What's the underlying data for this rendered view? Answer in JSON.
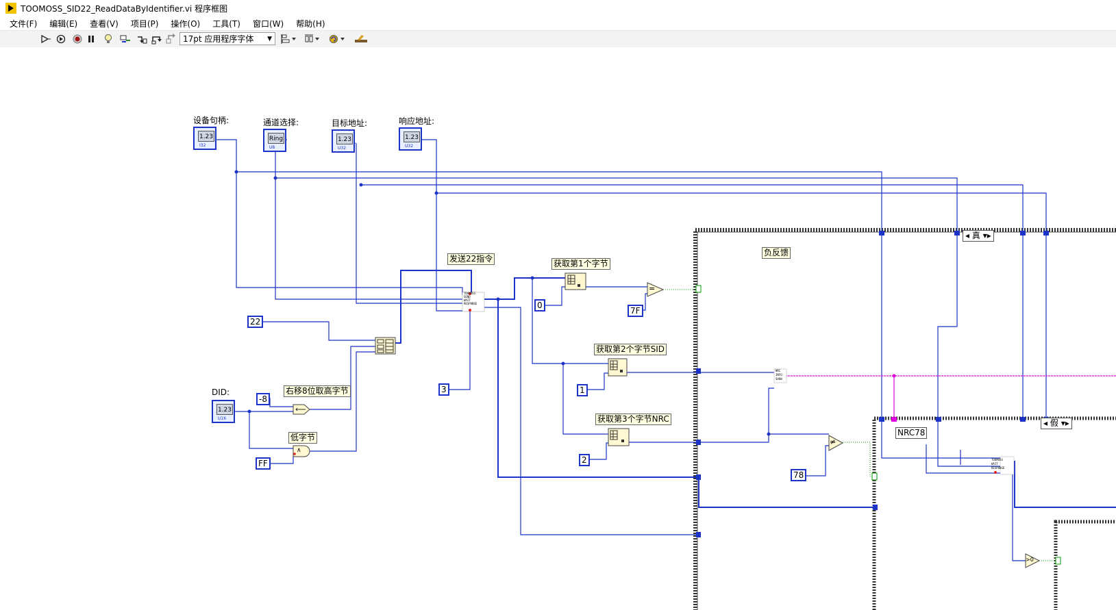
{
  "window": {
    "title": "TOOMOSS_SID22_ReadDataByIdentifier.vi 程序框图"
  },
  "menu": [
    {
      "label": "文件(F)"
    },
    {
      "label": "编辑(E)"
    },
    {
      "label": "查看(V)"
    },
    {
      "label": "项目(P)"
    },
    {
      "label": "操作(O)"
    },
    {
      "label": "工具(T)"
    },
    {
      "label": "窗口(W)"
    },
    {
      "label": "帮助(H)"
    }
  ],
  "toolbar": {
    "font_select": "17pt 应用程序字体",
    "icons": [
      "run-icon",
      "run-continuously-icon",
      "abort-icon",
      "pause-icon",
      "highlight-execution-icon",
      "retain-wire-values-icon",
      "step-into-icon",
      "step-over-icon",
      "step-out-icon",
      "align-objects-icon",
      "distribute-objects-icon",
      "reorder-icon",
      "clean-up-diagram-icon"
    ]
  },
  "diagram": {
    "controls": [
      {
        "label": "设备句柄:",
        "type": "I32",
        "display": "1.23"
      },
      {
        "label": "通道选择:",
        "type": "U8",
        "display": "Ring"
      },
      {
        "label": "目标地址:",
        "type": "U32",
        "display": "1.23"
      },
      {
        "label": "响应地址:",
        "type": "U32",
        "display": "1.23"
      },
      {
        "label": "DID:",
        "type": "U16",
        "display": "1.23"
      }
    ],
    "constants": {
      "c22": "22",
      "c_neg8": "-8",
      "cFF": "FF",
      "c3": "3",
      "c0": "0",
      "c7F": "7F",
      "c1": "1",
      "c2": "2",
      "c78": "78"
    },
    "notes": {
      "send22": "发送22指令",
      "shift_right": "右移8位取高字节",
      "low_byte": "低字节",
      "get_byte1": "获取第1个字节",
      "get_byte2": "获取第2个字节SID",
      "get_byte3": "获取第3个字节NRC",
      "negative_feedback": "负反馈",
      "nrc78": "NRC78"
    },
    "subvi_terminals": {
      "toomoss": "TOOMOSS",
      "send": "SEND",
      "wait": "WAIT",
      "response": "RESPONSE"
    },
    "nrc_terminals": {
      "nrc": "NRC",
      "info": "INFO",
      "show": "SHOW"
    },
    "case_selectors": {
      "outer": "真",
      "inner": "假"
    },
    "operators": {
      "equal": "=",
      "not_equal": "≠",
      "greater_zero": ">0",
      "and": "∧"
    }
  },
  "colors": {
    "wire_int": "#1c33c8",
    "wire_string": "#e000e0",
    "wire_bool": "#009900",
    "case_border": "#444444",
    "note_bg": "#ffffe1"
  }
}
